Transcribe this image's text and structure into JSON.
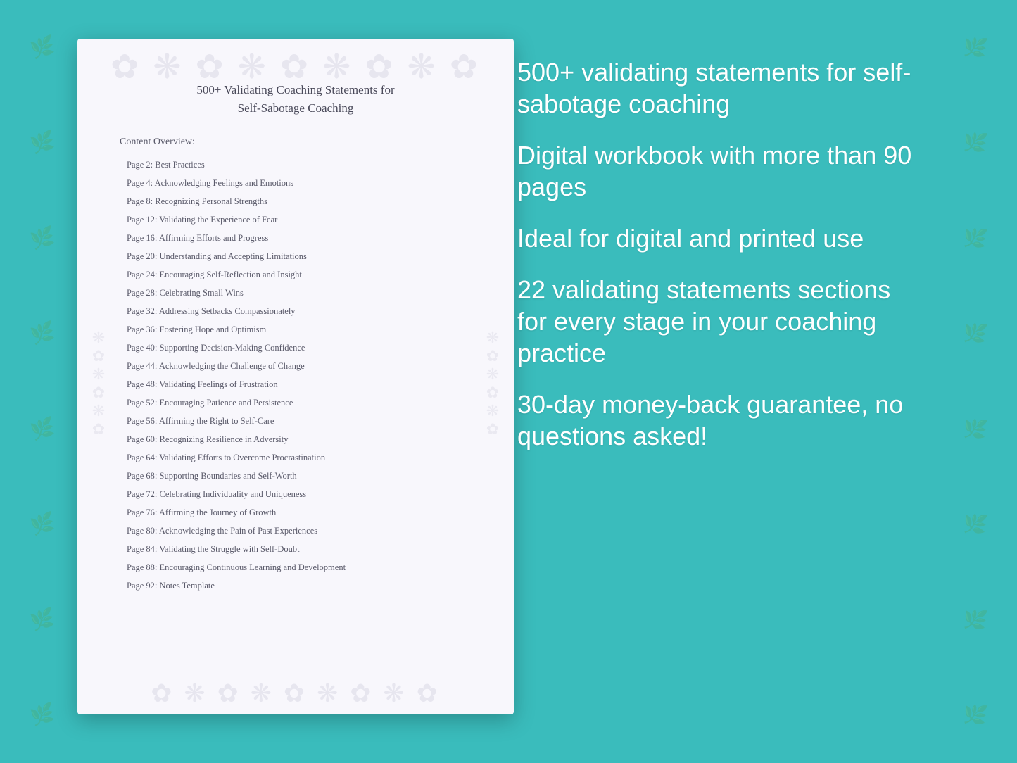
{
  "background_color": "#3abcbc",
  "document": {
    "title_line1": "500+ Validating Coaching Statements for",
    "title_line2": "Self-Sabotage Coaching",
    "section_label": "Content Overview:",
    "toc_items": [
      {
        "page": "Page  2:",
        "title": "Best Practices"
      },
      {
        "page": "Page  4:",
        "title": "Acknowledging Feelings and Emotions"
      },
      {
        "page": "Page  8:",
        "title": "Recognizing Personal Strengths"
      },
      {
        "page": "Page 12:",
        "title": "Validating the Experience of Fear"
      },
      {
        "page": "Page 16:",
        "title": "Affirming Efforts and Progress"
      },
      {
        "page": "Page 20:",
        "title": "Understanding and Accepting Limitations"
      },
      {
        "page": "Page 24:",
        "title": "Encouraging Self-Reflection and Insight"
      },
      {
        "page": "Page 28:",
        "title": "Celebrating Small Wins"
      },
      {
        "page": "Page 32:",
        "title": "Addressing Setbacks Compassionately"
      },
      {
        "page": "Page 36:",
        "title": "Fostering Hope and Optimism"
      },
      {
        "page": "Page 40:",
        "title": "Supporting Decision-Making Confidence"
      },
      {
        "page": "Page 44:",
        "title": "Acknowledging the Challenge of Change"
      },
      {
        "page": "Page 48:",
        "title": "Validating Feelings of Frustration"
      },
      {
        "page": "Page 52:",
        "title": "Encouraging Patience and Persistence"
      },
      {
        "page": "Page 56:",
        "title": "Affirming the Right to Self-Care"
      },
      {
        "page": "Page 60:",
        "title": "Recognizing Resilience in Adversity"
      },
      {
        "page": "Page 64:",
        "title": "Validating Efforts to Overcome Procrastination"
      },
      {
        "page": "Page 68:",
        "title": "Supporting Boundaries and Self-Worth"
      },
      {
        "page": "Page 72:",
        "title": "Celebrating Individuality and Uniqueness"
      },
      {
        "page": "Page 76:",
        "title": "Affirming the Journey of Growth"
      },
      {
        "page": "Page 80:",
        "title": "Acknowledging the Pain of Past Experiences"
      },
      {
        "page": "Page 84:",
        "title": "Validating the Struggle with Self-Doubt"
      },
      {
        "page": "Page 88:",
        "title": "Encouraging Continuous Learning and Development"
      },
      {
        "page": "Page 92:",
        "title": "Notes Template"
      }
    ]
  },
  "right_panel": {
    "feature1": "500+ validating statements for self-sabotage coaching",
    "feature2": "Digital workbook with more than 90 pages",
    "feature3": "Ideal for digital and printed use",
    "feature4": "22 validating statements sections for every stage in your coaching practice",
    "feature5": "30-day money-back guarantee, no questions asked!"
  }
}
